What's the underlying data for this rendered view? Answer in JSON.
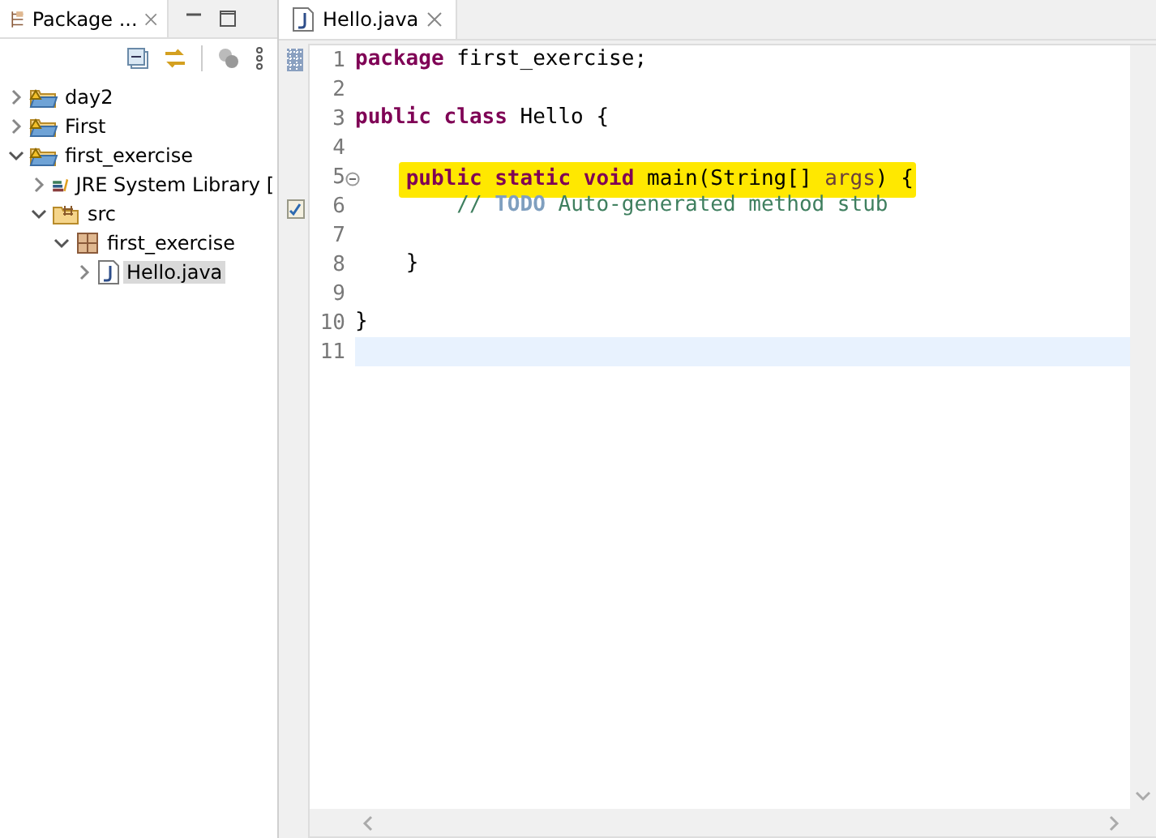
{
  "explorer": {
    "title": "Package ...",
    "tree": [
      {
        "label": "day2",
        "kind": "project",
        "expanded": false,
        "selected": false
      },
      {
        "label": "First",
        "kind": "project",
        "expanded": false,
        "selected": false
      },
      {
        "label": "first_exercise",
        "kind": "project",
        "expanded": true,
        "selected": false,
        "children": [
          {
            "label": "JRE System Library [",
            "kind": "library",
            "expanded": false,
            "selected": false
          },
          {
            "label": "src",
            "kind": "source-folder",
            "expanded": true,
            "selected": false,
            "children": [
              {
                "label": "first_exercise",
                "kind": "package",
                "expanded": true,
                "selected": false,
                "children": [
                  {
                    "label": "Hello.java",
                    "kind": "java-file",
                    "expanded": false,
                    "selected": true
                  }
                ]
              }
            ]
          }
        ]
      }
    ]
  },
  "editor": {
    "tab": {
      "label": "Hello.java",
      "selected": true
    },
    "lines": [
      {
        "number": "1",
        "changed": true,
        "tokens": [
          {
            "kind": "keyword",
            "text": "package "
          },
          {
            "kind": "plain",
            "text": "first_exercise;"
          }
        ]
      },
      {
        "number": "2"
      },
      {
        "number": "3",
        "tokens": [
          {
            "kind": "keyword",
            "text": "public class "
          },
          {
            "kind": "plain",
            "text": "Hello {"
          }
        ]
      },
      {
        "number": "4"
      },
      {
        "number": "5",
        "folded": false,
        "highlighted": true,
        "tokens": [
          {
            "kind": "keyword",
            "text": "    public static void "
          },
          {
            "kind": "plain",
            "text": "main(String[] "
          },
          {
            "kind": "param",
            "text": "args"
          },
          {
            "kind": "plain",
            "text": ") {"
          }
        ]
      },
      {
        "number": "6",
        "task": true,
        "tokens": [
          {
            "kind": "comment",
            "text": "        // "
          },
          {
            "kind": "todo",
            "text": "TODO"
          },
          {
            "kind": "comment",
            "text": " Auto-generated method stub"
          }
        ]
      },
      {
        "number": "7"
      },
      {
        "number": "8",
        "tokens": [
          {
            "kind": "plain",
            "text": "    }"
          }
        ]
      },
      {
        "number": "9"
      },
      {
        "number": "10",
        "tokens": [
          {
            "kind": "plain",
            "text": "}"
          }
        ]
      },
      {
        "number": "11",
        "current": true
      }
    ]
  }
}
